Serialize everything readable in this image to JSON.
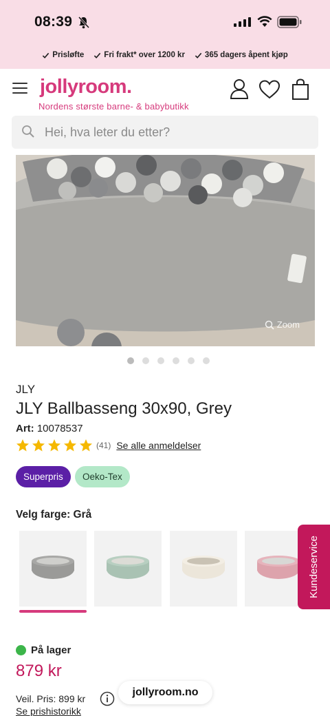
{
  "status_bar": {
    "time": "08:39"
  },
  "promo": [
    {
      "label": "Prisløfte"
    },
    {
      "label": "Fri frakt* over 1200 kr"
    },
    {
      "label": "365 dagers åpent kjøp"
    }
  ],
  "header": {
    "logo": "jollyroom.",
    "tagline": "Nordens største barne- & babybutikk"
  },
  "search": {
    "placeholder": "Hei, hva leter du etter?"
  },
  "gallery": {
    "zoom_label": "Zoom",
    "dot_count": 6,
    "active_index": 0
  },
  "product": {
    "brand": "JLY",
    "title": "JLY Ballbasseng 30x90, Grey",
    "art_label": "Art:",
    "art_number": "10078537",
    "rating": {
      "stars": 5,
      "count": "(41)",
      "link": "Se alle anmeldelser"
    },
    "badges": [
      "Superpris",
      "Oeko-Tex"
    ],
    "color_label": "Velg farge: Grå",
    "swatches": [
      {
        "color": "#9a9a98",
        "name": "Grå"
      },
      {
        "color": "#a9c2b3",
        "name": "Mint"
      },
      {
        "color": "#ece6da",
        "name": "Beige"
      },
      {
        "color": "#dda3ac",
        "name": "Rosa"
      }
    ],
    "stock": "På lager",
    "price": "879 kr",
    "veil_pris": "Veil. Pris: 899 kr",
    "price_history": "Se prishistorikk"
  },
  "kundeservice": "Kundeservice",
  "url": "jollyroom.no",
  "colors": {
    "brand": "#d63a7c",
    "superpris": "#5b1fa6",
    "oeko": "#b3e8c8",
    "stock": "#3cb54a",
    "star": "#f5b800"
  }
}
